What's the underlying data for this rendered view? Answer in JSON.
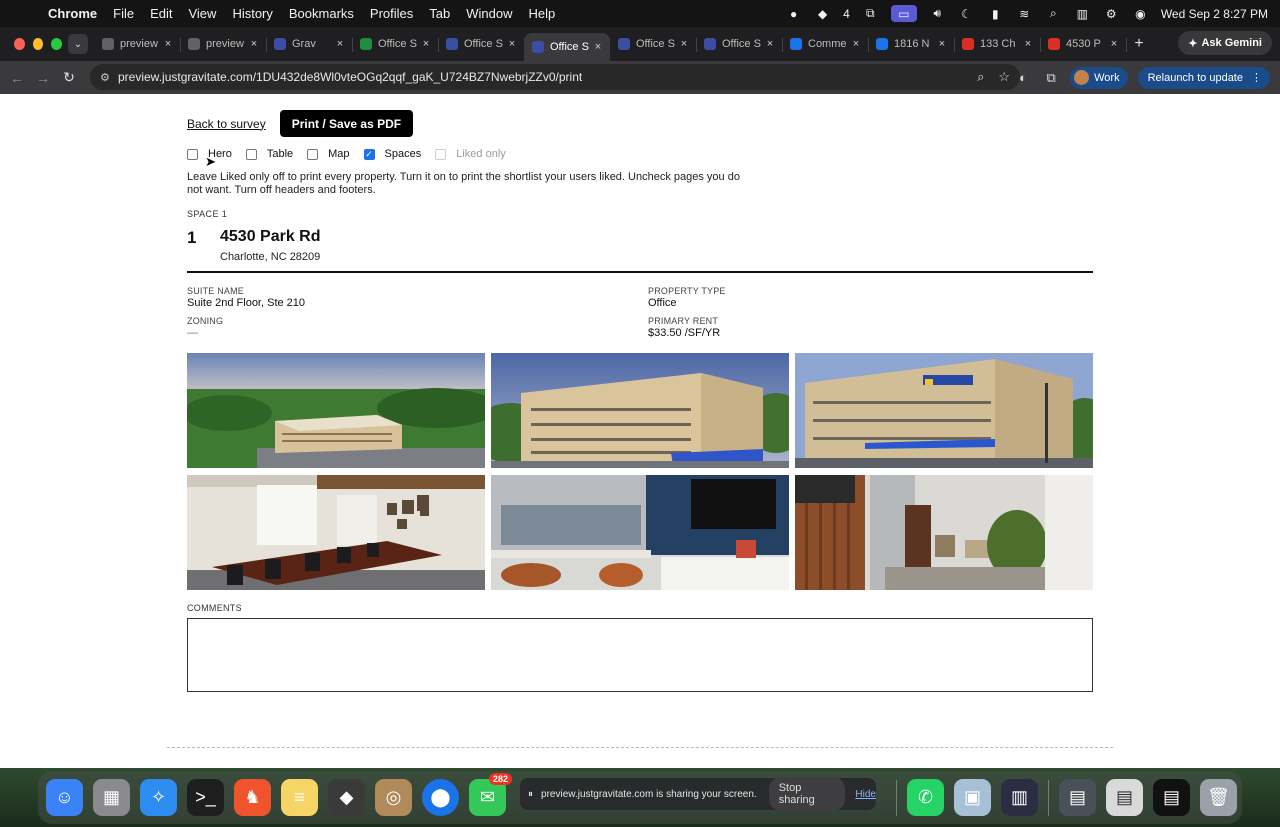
{
  "menubar": {
    "app_name": "Chrome",
    "menus": [
      "File",
      "Edit",
      "View",
      "History",
      "Bookmarks",
      "Profiles",
      "Tab",
      "Window",
      "Help"
    ],
    "badge_count": "4",
    "datetime": "Wed Sep 2  8:27 PM"
  },
  "tabs": [
    {
      "title": "preview",
      "favicon": "globe-icon",
      "color": "#5f6368",
      "active": false
    },
    {
      "title": "preview",
      "favicon": "globe-icon",
      "color": "#5f6368",
      "active": false
    },
    {
      "title": "Grav",
      "favicon": "gravitate-icon",
      "color": "#3c4ea3",
      "active": false
    },
    {
      "title": "Office S",
      "favicon": "sheets-icon",
      "color": "#1e8e3e",
      "active": false
    },
    {
      "title": "Office S",
      "favicon": "gravitate-icon",
      "color": "#3c4ea3",
      "active": false
    },
    {
      "title": "Office S",
      "favicon": "gravitate-icon",
      "color": "#3c4ea3",
      "active": true
    },
    {
      "title": "Office S",
      "favicon": "gravitate-icon",
      "color": "#3c4ea3",
      "active": false
    },
    {
      "title": "Office S",
      "favicon": "gravitate-icon",
      "color": "#3c4ea3",
      "active": false
    },
    {
      "title": "Comme",
      "favicon": "chart-icon",
      "color": "#1a73e8",
      "active": false
    },
    {
      "title": "1816 N",
      "favicon": "chart-icon",
      "color": "#1a73e8",
      "active": false
    },
    {
      "title": "133 Ch",
      "favicon": "costar-icon",
      "color": "#d93025",
      "active": false
    },
    {
      "title": "4530 P",
      "favicon": "costar-icon",
      "color": "#d93025",
      "active": false
    }
  ],
  "tabbar": {
    "new_tab": "+",
    "gemini_label": "Ask Gemini"
  },
  "addressbar": {
    "url": "preview.justgravitate.com/1DU432de8Wl0vteOGq2qqf_gaK_U724BZ7NwebrjZZv0/print",
    "profile_name": "Work",
    "relaunch_label": "Relaunch to update"
  },
  "page": {
    "back_link": "Back to survey",
    "print_button": "Print / Save as PDF",
    "options": [
      {
        "label": "Hero",
        "checked": false,
        "disabled": false
      },
      {
        "label": "Table",
        "checked": false,
        "disabled": false
      },
      {
        "label": "Map",
        "checked": false,
        "disabled": false
      },
      {
        "label": "Spaces",
        "checked": true,
        "disabled": false
      },
      {
        "label": "Liked only",
        "checked": false,
        "disabled": true
      }
    ],
    "help_text": "Leave Liked only off to print every property. Turn it on to print the shortlist your users liked. Uncheck pages you do not want. Turn off headers and footers.",
    "space": {
      "label": "SPACE 1",
      "number": "1",
      "name": "4530 Park Rd",
      "address": "Charlotte, NC 28209",
      "details": {
        "suite_label": "SUITE NAME",
        "suite_value": "Suite 2nd Floor, Ste 210",
        "zoning_label": "ZONING",
        "zoning_value": "—",
        "type_label": "PROPERTY TYPE",
        "type_value": "Office",
        "rent_label": "PRIMARY RENT",
        "rent_value": "$33.50 /SF/YR"
      },
      "photos": [
        "aerial-building-photo",
        "building-facade-photo",
        "building-entrance-photo",
        "conference-room-photo",
        "lounge-area-photo",
        "reception-lobby-photo"
      ]
    },
    "comments_label": "COMMENTS",
    "comments_value": ""
  },
  "dock": {
    "messages_badge": "282",
    "share_text": "preview.justgravitate.com is sharing your screen.",
    "stop_sharing": "Stop sharing",
    "hide": "Hide"
  }
}
